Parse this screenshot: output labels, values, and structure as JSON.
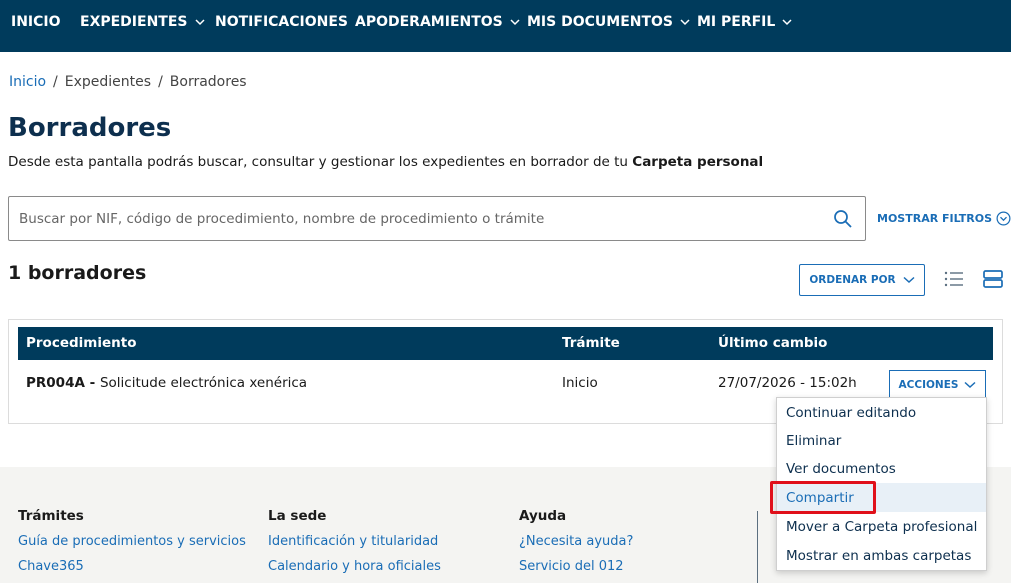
{
  "nav": {
    "items": [
      {
        "label": "INICIO",
        "has_menu": false
      },
      {
        "label": "EXPEDIENTES",
        "has_menu": true
      },
      {
        "label": "NOTIFICACIONES",
        "has_menu": false
      },
      {
        "label": "APODERAMIENTOS",
        "has_menu": true
      },
      {
        "label": "MIS DOCUMENTOS",
        "has_menu": true
      },
      {
        "label": "MI PERFIL",
        "has_menu": true
      }
    ]
  },
  "breadcrumb": {
    "home": "Inicio",
    "sep1": "/",
    "level1": "Expedientes",
    "sep2": "/",
    "current": "Borradores"
  },
  "page": {
    "title": "Borradores",
    "description": "Desde esta pantalla podrás buscar, consultar y gestionar los expedientes en borrador de tu ",
    "description_bold": "Carpeta personal"
  },
  "search": {
    "placeholder": "Buscar por NIF, código de procedimiento, nombre de procedimiento o trámite",
    "value": ""
  },
  "filters_label": "MOSTRAR FILTROS",
  "results": {
    "count_title": "1 borradores",
    "sort_label": "ORDENAR POR"
  },
  "table": {
    "headers": [
      "Procedimiento",
      "Trámite",
      "Último cambio"
    ],
    "rows": [
      {
        "code": "PR004A",
        "separator": " - ",
        "name": "Solicitude electrónica xenérica",
        "tramite": "Inicio",
        "last_change": "27/07/2026 - 15:02h",
        "actions_label": "ACCIONES"
      }
    ]
  },
  "actions_menu": {
    "items": [
      "Continuar editando",
      "Eliminar",
      "Ver documentos",
      "Compartir",
      "Mover a Carpeta profesional",
      "Mostrar en ambas carpetas"
    ],
    "highlighted_index": 3
  },
  "footer": {
    "columns": [
      {
        "heading": "Trámites",
        "links": [
          "Guía de procedimientos y servicios",
          "Chave365"
        ]
      },
      {
        "heading": "La sede",
        "links": [
          "Identificación y titularidad",
          "Calendario y hora oficiales"
        ]
      },
      {
        "heading": "Ayuda",
        "links": [
          "¿Necesita ayuda?",
          "Servicio del 012"
        ]
      }
    ]
  },
  "colors": {
    "nav_bg": "#003b5c",
    "link": "#1a6db6",
    "title": "#0d2f4e",
    "highlight": "#e0101a",
    "footer_bg": "#f4f4f2"
  }
}
